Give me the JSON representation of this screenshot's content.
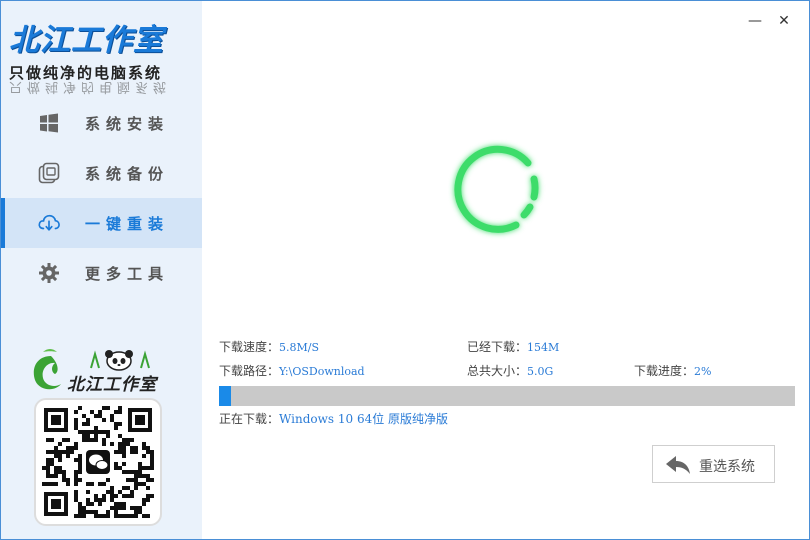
{
  "brand": {
    "title": "北江工作室",
    "subtitle": "只做纯净的电脑系统",
    "subtitle_reflection": "只做纯净的电脑系统"
  },
  "window_controls": {
    "minimize": "—",
    "close": "✕"
  },
  "nav": [
    {
      "label": "系统安装",
      "icon": "windows-icon",
      "active": false
    },
    {
      "label": "系统备份",
      "icon": "backup-icon",
      "active": false
    },
    {
      "label": "一键重装",
      "icon": "cloud-download-icon",
      "active": true
    },
    {
      "label": "更多工具",
      "icon": "gear-icon",
      "active": false
    }
  ],
  "logo2": {
    "text": "北江工作室"
  },
  "download": {
    "speed_label": "下载速度：",
    "speed_value": "5.8M/S",
    "downloaded_label": "已经下载：",
    "downloaded_value": "154M",
    "path_label": "下载路径：",
    "path_value": "Y:\\OSDownload",
    "total_label": "总共大小：",
    "total_value": "5.0G",
    "progress_label": "下载进度：",
    "progress_value": "2%",
    "progress_fraction": 0.02,
    "current_label": "正在下载：",
    "current_value": "Windows 10  64位 原版纯净版"
  },
  "reinstall_button": {
    "label": "重选系统"
  },
  "colors": {
    "accent": "#1a7ad8",
    "progress_fill": "#1a8ae8",
    "spinner": "#3ddc6a",
    "sidebar_bg": "#eaf2fb"
  }
}
